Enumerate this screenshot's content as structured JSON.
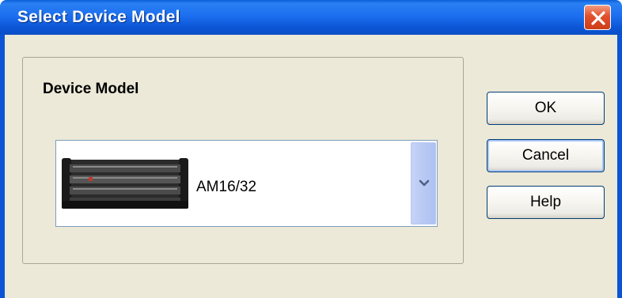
{
  "window": {
    "title": "Select Device Model"
  },
  "group": {
    "label": "Device Model"
  },
  "combo": {
    "selected_value": "AM16/32",
    "image_icon": "am16-32-multiplexer-image",
    "dropdown_icon": "chevron-down-icon"
  },
  "buttons": {
    "ok": "OK",
    "cancel": "Cancel",
    "help": "Help"
  },
  "colors": {
    "titlebar": "#0b55d5",
    "dialog_bg": "#ece9d8",
    "close_button": "#e2502c",
    "button_border": "#003c74"
  }
}
